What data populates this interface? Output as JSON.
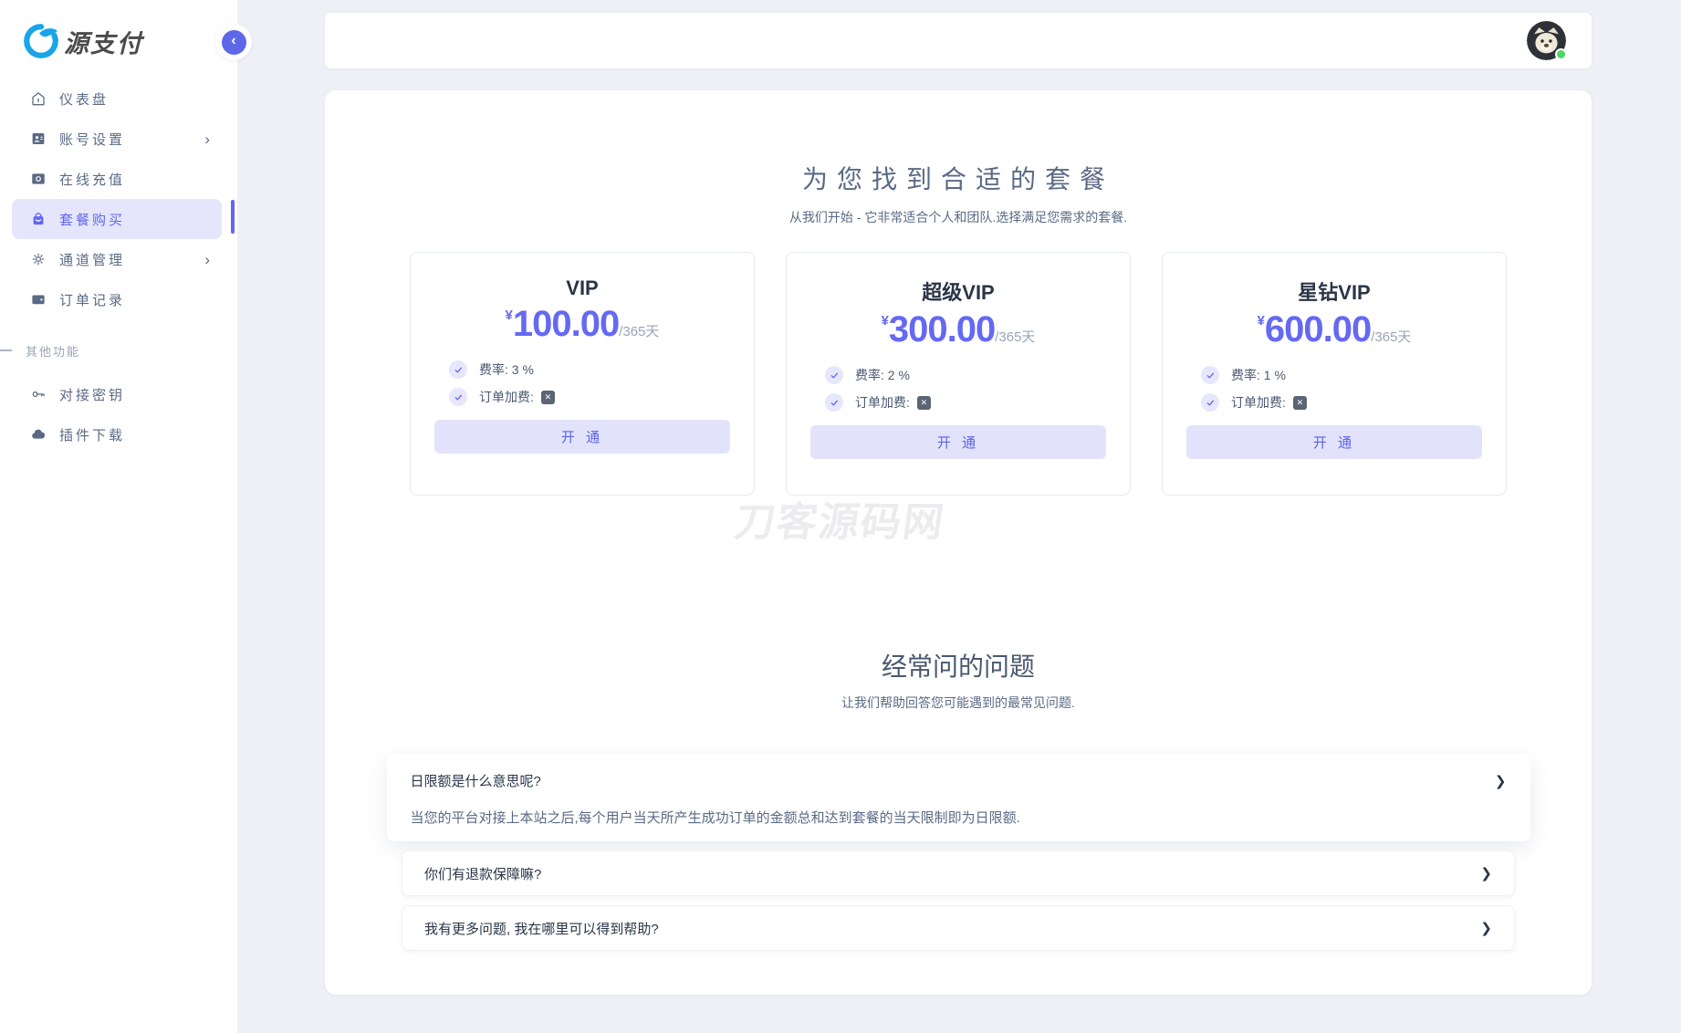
{
  "brand": {
    "logo_text": "源支付"
  },
  "sidebar": {
    "items": [
      {
        "label": "仪表盘"
      },
      {
        "label": "账号设置",
        "has_submenu": true
      },
      {
        "label": "在线充值"
      },
      {
        "label": "套餐购买",
        "active": true
      },
      {
        "label": "通道管理",
        "has_submenu": true
      },
      {
        "label": "订单记录"
      }
    ],
    "section_label": "其他功能",
    "extra_items": [
      {
        "label": "对接密钥"
      },
      {
        "label": "插件下载"
      }
    ],
    "chevron": "›",
    "collapse_glyph": "‹"
  },
  "pricing": {
    "title": "为您找到合适的套餐",
    "subtitle": "从我们开始 - 它非常适合个人和团队.选择满足您需求的套餐.",
    "x_glyph": "✕",
    "plans": [
      {
        "name": "VIP",
        "currency": "¥",
        "price": "100.00",
        "period": "/365天",
        "features": [
          {
            "text": "费率: 3 %"
          },
          {
            "text": "订单加费:",
            "icon": "x-square-icon"
          }
        ],
        "button": "开 通"
      },
      {
        "name": "超级VIP",
        "currency": "¥",
        "price": "300.00",
        "period": "/365天",
        "features": [
          {
            "text": "费率: 2 %"
          },
          {
            "text": "订单加费:",
            "icon": "x-square-icon"
          }
        ],
        "button": "开 通"
      },
      {
        "name": "星钻VIP",
        "currency": "¥",
        "price": "600.00",
        "period": "/365天",
        "features": [
          {
            "text": "费率: 1 %"
          },
          {
            "text": "订单加费:",
            "icon": "x-square-icon"
          }
        ],
        "button": "开 通"
      }
    ]
  },
  "watermark": "刀客源码网",
  "faq": {
    "title": "经常问的问题",
    "subtitle": "让我们帮助回答您可能遇到的最常见问题.",
    "chevron": "❯",
    "items": [
      {
        "question": "日限额是什么意思呢?",
        "answer": "当您的平台对接上本站之后,每个用户当天所产生成功订单的金额总和达到套餐的当天限制即为日限额.",
        "expanded": true
      },
      {
        "question": "你们有退款保障嘛?",
        "expanded": false
      },
      {
        "question": "我有更多问题, 我在哪里可以得到帮助?",
        "expanded": false
      }
    ]
  },
  "colors": {
    "accent": "#6266f1",
    "active_item_bg": "#e5e6fc",
    "button_bg": "#e2e3fb",
    "button_text": "#5c62e9",
    "status_online": "#4cd964",
    "page_bg": "#eff0f6"
  }
}
